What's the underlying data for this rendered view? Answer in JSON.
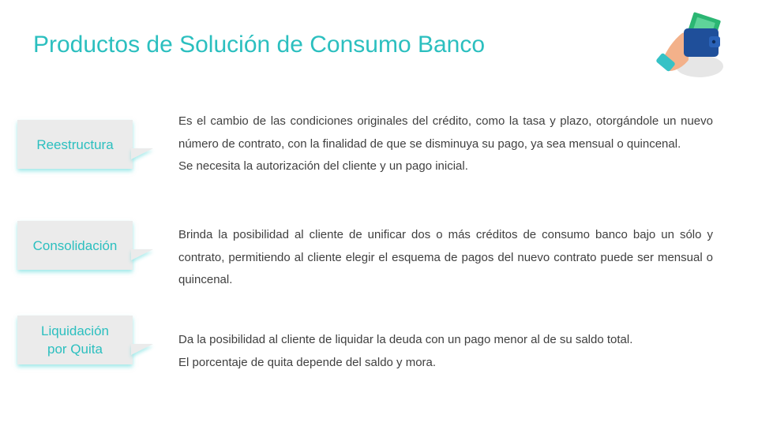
{
  "title": "Productos de Solución de Consumo Banco",
  "accent_color": "#2bbfbf",
  "header_icon": "hand-wallet-icon",
  "products": [
    {
      "name": "Reestructura",
      "paragraphs": [
        "Es el cambio de las condiciones originales del crédito, como la tasa y plazo, otorgándole un nuevo número de contrato, con la finalidad de que se disminuya su pago, ya sea mensual o quincenal.",
        "Se necesita la autorización del cliente y un pago inicial."
      ]
    },
    {
      "name": "Consolidación",
      "paragraphs": [
        "Brinda la posibilidad al cliente de unificar dos o más créditos de consumo banco bajo un sólo y contrato, permitiendo al cliente elegir el esquema de pagos del nuevo contrato puede ser mensual  o quincenal."
      ]
    },
    {
      "name": "Liquidación\npor Quita",
      "paragraphs": [
        "Da la posibilidad al cliente de liquidar la deuda con un pago menor al de su saldo total.",
        "El porcentaje de quita depende del saldo y mora."
      ]
    }
  ]
}
